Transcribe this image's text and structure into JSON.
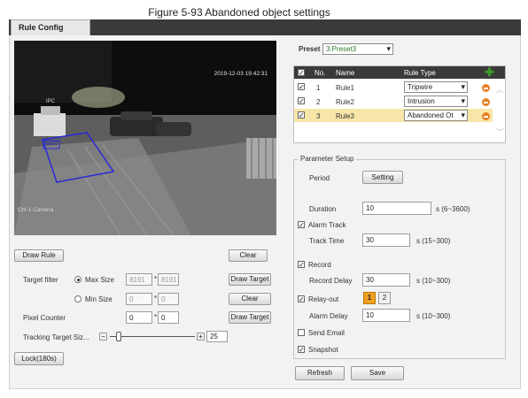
{
  "figure_caption": "Figure 5-93 Abandoned object settings",
  "tab": {
    "label": "Rule Config"
  },
  "video": {
    "timestamp": "2019-12-03 19:42:31",
    "overlay_text": "IPC",
    "channel_label": "CH-1-Camera",
    "rule_label": "Rule3"
  },
  "left": {
    "draw_rule": "Draw Rule",
    "clear": "Clear",
    "target_filter_label": "Target filter",
    "max_size_label": "Max Size",
    "max_w": "8191",
    "max_h": "8191",
    "min_size_label": "Min Size",
    "min_w": "0",
    "min_h": "0",
    "times": "*",
    "draw_target": "Draw Target",
    "clear2": "Clear",
    "pixel_counter_label": "Pixel Counter",
    "pixel_w": "0",
    "pixel_h": "0",
    "draw_target2": "Draw Target",
    "tracking_label": "Tracking Target Siz...",
    "tracking_value": "25",
    "tracking_fraction": 0.1,
    "minus_glyph": "−",
    "plus_glyph": "+",
    "lock_button": "Lock(180s)"
  },
  "preset": {
    "label": "Preset",
    "value": "3:Preset3"
  },
  "rules": {
    "headers": {
      "no": "No.",
      "name": "Name",
      "type": "Rule Type"
    },
    "rows": [
      {
        "checked": true,
        "no": "1",
        "name": "Rule1",
        "type": "Tripwire",
        "highlight": false
      },
      {
        "checked": true,
        "no": "2",
        "name": "Rule2",
        "type": "Intrusion",
        "highlight": false
      },
      {
        "checked": true,
        "no": "3",
        "name": "Rule3",
        "type": "Abandoned Ot",
        "highlight": true
      }
    ]
  },
  "params": {
    "legend": "Parameter Setup",
    "period_label": "Period",
    "setting_btn": "Setting",
    "duration_label": "Duration",
    "duration_value": "10",
    "duration_unit": "s (6~3600)",
    "alarm_track_label": "Alarm Track",
    "track_time_label": "Track Time",
    "track_time_value": "30",
    "track_time_unit": "s (15~300)",
    "record_label": "Record",
    "record_delay_label": "Record Delay",
    "record_delay_value": "30",
    "record_delay_unit": "s (10~300)",
    "relay_out_label": "Relay-out",
    "relay_1": "1",
    "relay_2": "2",
    "alarm_delay_label": "Alarm Delay",
    "alarm_delay_value": "10",
    "alarm_delay_unit": "s (10~300)",
    "send_email_label": "Send Email",
    "snapshot_label": "Snapshot",
    "check_glyph": "✓"
  },
  "footer": {
    "refresh": "Refresh",
    "save": "Save"
  },
  "colors": {
    "header_dark": "#3a3a3a",
    "highlight_row": "#f7e6a8",
    "orange": "#f0a020",
    "remove_icon": "#e67e22",
    "add_icon": "#3a9c2a",
    "draw_region": "#2a2ad8"
  }
}
